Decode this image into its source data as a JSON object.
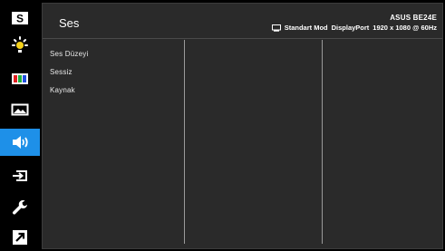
{
  "sidebar": {
    "items": [
      {
        "icon": "s-splendid-icon"
      },
      {
        "icon": "brightness-icon"
      },
      {
        "icon": "color-bars-icon"
      },
      {
        "icon": "image-icon"
      },
      {
        "icon": "sound-icon",
        "active": true
      },
      {
        "icon": "input-select-icon"
      },
      {
        "icon": "wrench-system-icon"
      },
      {
        "icon": "shortcut-icon"
      }
    ],
    "active_color": "#1e90e8"
  },
  "header": {
    "title": "Ses",
    "model": "ASUS BE24E",
    "mode": "Standart Mod",
    "input": "DisplayPort",
    "resolution": "1920 x 1080 @ 60Hz"
  },
  "menu": {
    "items": [
      "Ses Düzeyi",
      "Sessiz",
      "Kaynak"
    ]
  }
}
